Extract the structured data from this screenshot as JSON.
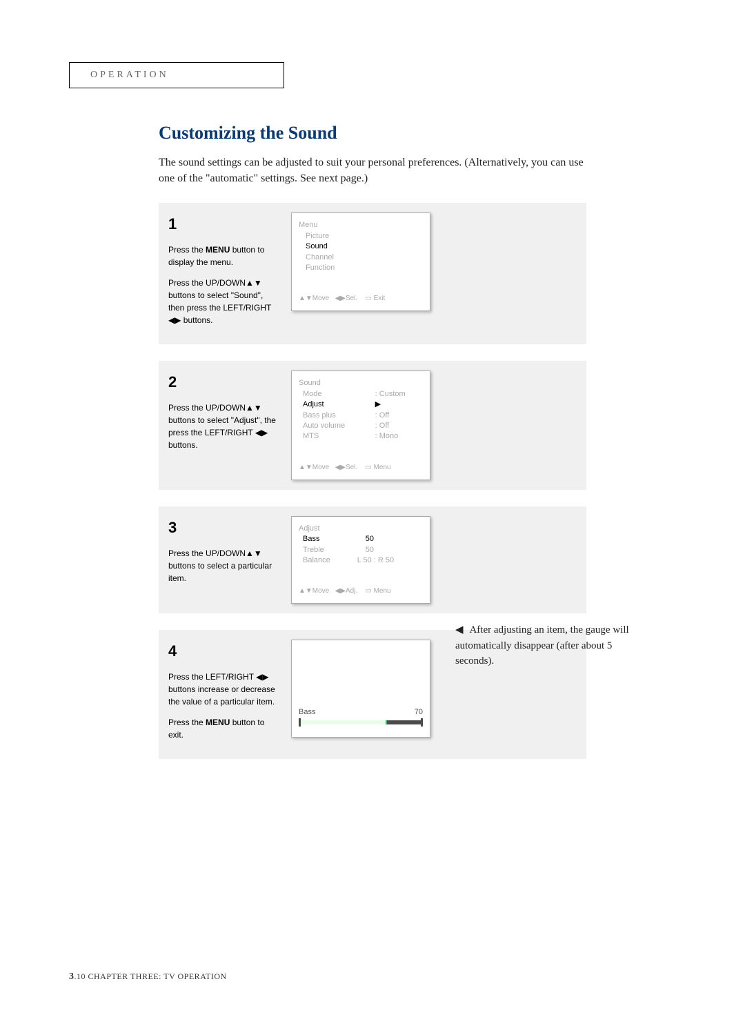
{
  "header": {
    "title": "OPERATION"
  },
  "section": {
    "title": "Customizing the Sound",
    "intro": "The sound settings can be adjusted to suit your personal preferences. (Alternatively, you can use one of the \"automatic\" settings. See next page.)"
  },
  "steps": [
    {
      "num": "1",
      "p1_a": "Press the ",
      "p1_b": "MENU",
      "p1_c": " button to display the menu.",
      "p2": "Press the UP/DOWN▲▼ buttons to select \"Sound\", then press the LEFT/RIGHT ◀▶ buttons.",
      "osd": {
        "title": "Menu",
        "items": [
          "Picture",
          "Sound",
          "Channel",
          "Function"
        ],
        "selected": "Sound",
        "footer_move": "▲▼Move",
        "footer_sel": "◀▶Sel.",
        "footer_exit": "▭ Exit"
      }
    },
    {
      "num": "2",
      "p1": "Press the UP/DOWN▲▼ buttons to select \"Adjust\", the press the LEFT/RIGHT ◀▶ buttons.",
      "osd": {
        "title": "Sound",
        "rows": [
          {
            "k": "Mode",
            "v": ": Custom"
          },
          {
            "k": "Adjust",
            "v": "▶",
            "sel": true
          },
          {
            "k": "Bass plus",
            "v": ": Off"
          },
          {
            "k": "Auto volume",
            "v": ": Off"
          },
          {
            "k": "MTS",
            "v": ": Mono"
          }
        ],
        "footer_move": "▲▼Move",
        "footer_sel": "◀▶Sel.",
        "footer_exit": "▭ Menu"
      }
    },
    {
      "num": "3",
      "p1": "Press the UP/DOWN▲▼ buttons to select a particular item.",
      "osd": {
        "title": "Adjust",
        "rows": [
          {
            "k": "Bass",
            "v": "50",
            "sel": true
          },
          {
            "k": "Treble",
            "v": "50"
          },
          {
            "k": "Balance",
            "v": "L  50 : R  50"
          }
        ],
        "footer_move": "▲▼Move",
        "footer_adj": "◀▶Adj.",
        "footer_exit": "▭ Menu"
      }
    },
    {
      "num": "4",
      "p1": "Press the LEFT/RIGHT ◀▶ buttons increase or decrease the value of a particular item.",
      "p2_a": "Press the ",
      "p2_b": "MENU",
      "p2_c": " button to exit.",
      "osd": {
        "label": "Bass",
        "value": "70",
        "pct": 70
      }
    }
  ],
  "sidenote": {
    "arrow": "◀",
    "text": "  After adjusting an item, the gauge will automatically disappear (after about 5 seconds)."
  },
  "footer": {
    "pagenum": "3",
    "tail": ".10  CHAPTER THREE: TV OPERATION"
  }
}
